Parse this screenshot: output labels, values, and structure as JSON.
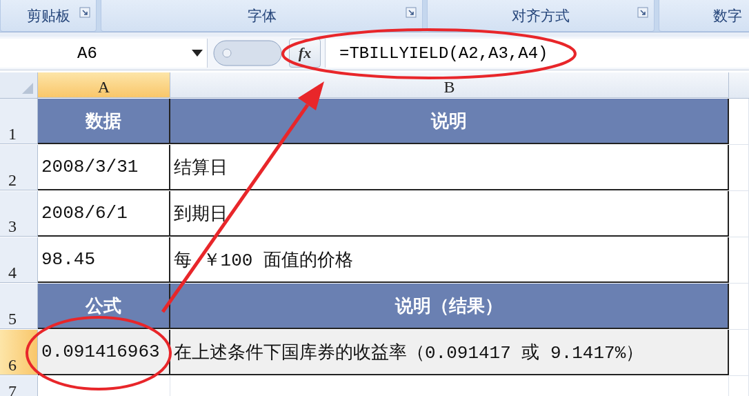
{
  "ribbon_groups": [
    {
      "label": "剪贴板",
      "launcher": true
    },
    {
      "label": "字体",
      "launcher": true
    },
    {
      "label": "对齐方式",
      "launcher": true
    },
    {
      "label": "数字"
    }
  ],
  "formula_bar": {
    "name_box": "A6",
    "function_label": "fx",
    "formula": "=TBILLYIELD(A2,A3,A4)"
  },
  "columns": [
    {
      "label": "A",
      "selected": true
    },
    {
      "label": "B",
      "selected": false
    }
  ],
  "rows": [
    {
      "number": "1",
      "selected": false,
      "kind": "header",
      "cells": [
        "数据",
        "说明"
      ]
    },
    {
      "number": "2",
      "selected": false,
      "kind": "data",
      "cells": [
        "2008/3/31",
        "结算日"
      ]
    },
    {
      "number": "3",
      "selected": false,
      "kind": "data",
      "cells": [
        "2008/6/1",
        "到期日"
      ]
    },
    {
      "number": "4",
      "selected": false,
      "kind": "data",
      "cells": [
        "98.45",
        "每 ￥100 面值的价格"
      ]
    },
    {
      "number": "5",
      "selected": false,
      "kind": "header",
      "cells": [
        "公式",
        "说明（结果）"
      ]
    },
    {
      "number": "6",
      "selected": true,
      "kind": "result",
      "cells": [
        "0.091416963",
        "在上述条件下国库券的收益率（0.091417 或 9.1417%）"
      ]
    },
    {
      "number": "7",
      "selected": false,
      "kind": "empty",
      "cells": []
    }
  ]
}
